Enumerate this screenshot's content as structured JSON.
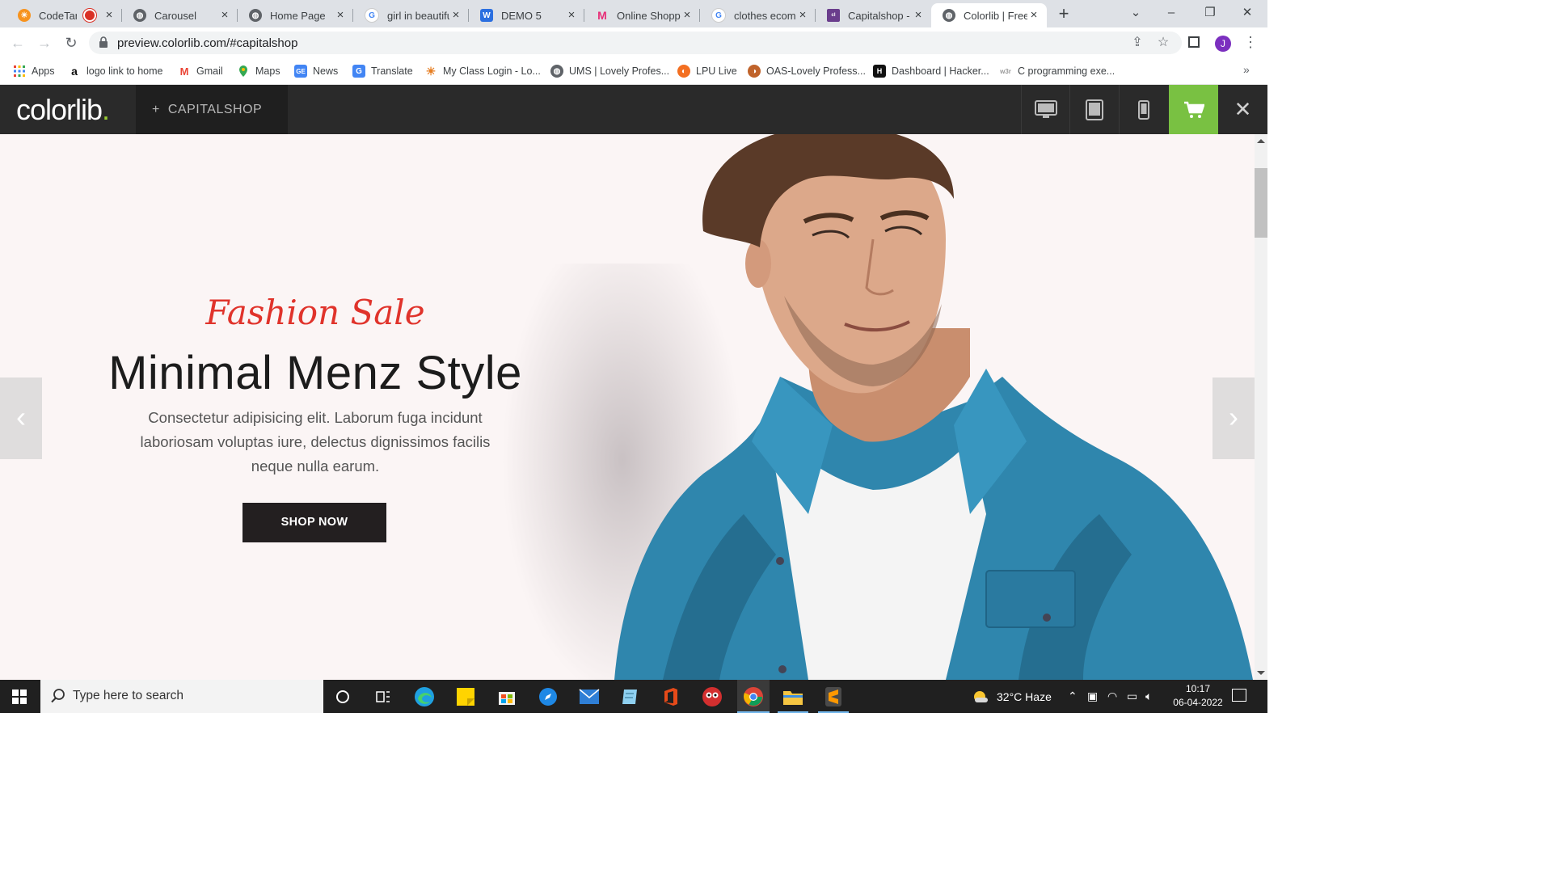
{
  "browser": {
    "tabs": [
      {
        "title": "CodeTantra",
        "favicon": "sun-favicon",
        "recording": true
      },
      {
        "title": "Carousel",
        "favicon": "globe-favicon"
      },
      {
        "title": "Home Page",
        "favicon": "globe-favicon"
      },
      {
        "title": "girl in beautiful",
        "favicon": "google-favicon"
      },
      {
        "title": "DEMO 5",
        "favicon": "w-favicon"
      },
      {
        "title": "Online Shopping",
        "favicon": "myntra-favicon"
      },
      {
        "title": "clothes ecommerce",
        "favicon": "google-favicon"
      },
      {
        "title": "Capitalshop -",
        "favicon": "colorlib-favicon"
      },
      {
        "title": "Colorlib | Free",
        "favicon": "globe-favicon",
        "active": true
      }
    ],
    "url": "preview.colorlib.com/#capitalshop",
    "profile_initial": "J",
    "bookmarks": [
      {
        "label": "Apps",
        "icon": "apps-grid-icon"
      },
      {
        "label": "logo link to home",
        "icon": "amazon-icon"
      },
      {
        "label": "Gmail",
        "icon": "gmail-icon"
      },
      {
        "label": "Maps",
        "icon": "maps-icon"
      },
      {
        "label": "News",
        "icon": "news-icon"
      },
      {
        "label": "Translate",
        "icon": "translate-icon"
      },
      {
        "label": "My Class Login - Lo...",
        "icon": "sun-icon"
      },
      {
        "label": "UMS | Lovely Profes...",
        "icon": "globe-icon"
      },
      {
        "label": "LPU Live",
        "icon": "lpu-icon"
      },
      {
        "label": "OAS-Lovely Profess...",
        "icon": "oas-icon"
      },
      {
        "label": "Dashboard | Hacker...",
        "icon": "hackerrank-icon"
      },
      {
        "label": "C programming exe...",
        "icon": "w3r-icon"
      }
    ]
  },
  "colorlib": {
    "logo_text": "colorlib",
    "logo_dot": ".",
    "theme_label": "CAPITALSHOP",
    "theme_plus": "+",
    "close_glyph": "✕"
  },
  "hero": {
    "eyebrow": "Fashion Sale",
    "headline": "Minimal Menz Style",
    "description": "Consectetur adipisicing elit. Laborum fuga incidunt laboriosam voluptas iure, delectus dignissimos facilis neque nulla earum.",
    "cta": "SHOP NOW",
    "prev_arrow": "‹",
    "next_arrow": "›"
  },
  "taskbar": {
    "search_placeholder": "Type here to search",
    "weather": "32°C  Haze",
    "time": "10:17",
    "date": "06-04-2022"
  },
  "colors": {
    "accent_green": "#79c142",
    "eyebrow_red": "#e0332b",
    "button_dark": "#231f20",
    "hero_bg": "#fbf5f5",
    "denim": "#2f86ad"
  }
}
